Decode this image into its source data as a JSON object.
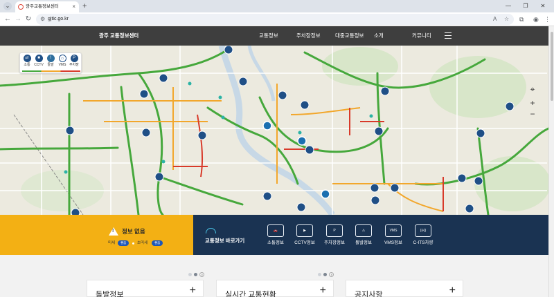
{
  "browser": {
    "tab_title": "광주교통정보센터",
    "url": "gjtic.go.kr"
  },
  "site": {
    "logo": "광주 교통정보센터",
    "menu": [
      "교통정보",
      "주차장정보",
      "대중교통정보",
      "소개",
      "커뮤니티"
    ]
  },
  "legend": {
    "items": [
      "소통",
      "CCTV",
      "돌발",
      "VMS",
      "주차장"
    ]
  },
  "map_controls": {
    "zoom_in": "+",
    "zoom_out": "−"
  },
  "air_quality": {
    "title": "정보 없음",
    "fine_dust_label": "미세",
    "fine_dust_value": "좋음",
    "ultrafine_dust_label": "초미세",
    "ultrafine_dust_value": "좋음"
  },
  "quick_links": {
    "title": "교통정보 바로가기",
    "items": [
      "소통정보",
      "CCTV정보",
      "주차장정보",
      "돌발정보",
      "VMS정보",
      "C-ITS차량"
    ]
  },
  "cards": [
    "돌발정보",
    "실시간 교통현황",
    "공지사항"
  ],
  "colors": {
    "header_bg": "#3e3e3e",
    "alert_yellow": "#f3b014",
    "quick_navy": "#1a3352",
    "marker_navy": "#1f4f86",
    "traffic_smooth": "#46a83c",
    "traffic_slow": "#f2a72c",
    "traffic_jam": "#d83a2a"
  }
}
